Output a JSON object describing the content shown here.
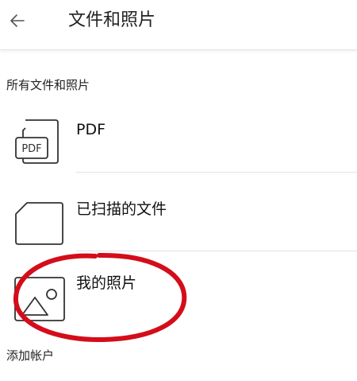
{
  "header": {
    "back_icon": "arrow-left-icon",
    "title": "文件和照片"
  },
  "sections": {
    "files_title": "所有文件和照片",
    "add_account": "添加帐户"
  },
  "items": [
    {
      "label": "PDF",
      "icon": "pdf-file-icon",
      "icon_text": "PDF"
    },
    {
      "label": "已扫描的文件",
      "icon": "folder-icon"
    },
    {
      "label": "我的照片",
      "icon": "image-icon"
    }
  ],
  "colors": {
    "icon_stroke": "#333333",
    "divider": "#e3e3e3",
    "annotation": "#d40d1a"
  }
}
